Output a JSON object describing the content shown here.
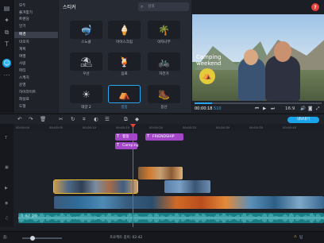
{
  "sidebar": {
    "items": [
      {
        "label": "모두"
      },
      {
        "label": "즐겨찾기"
      },
      {
        "label": "트렌딩"
      },
      {
        "label": "인기"
      },
      {
        "label": "배경"
      },
      {
        "label": "미모지"
      },
      {
        "label": "계획"
      },
      {
        "label": "여행"
      },
      {
        "label": "사랑"
      },
      {
        "label": "파티"
      },
      {
        "label": "스케치"
      },
      {
        "label": "운영"
      },
      {
        "label": "하이라이트"
      },
      {
        "label": "화살표"
      },
      {
        "label": "도형"
      }
    ],
    "selected_index": 4
  },
  "sticker_panel": {
    "title": "스티커",
    "search_placeholder": "검색",
    "stickers": [
      {
        "label": "스노클",
        "icon": "snorkel-icon",
        "glyph": "🤿"
      },
      {
        "label": "아이스크림",
        "icon": "ice-cream-icon",
        "glyph": "🍦"
      },
      {
        "label": "야자나무",
        "icon": "palm-tree-icon",
        "glyph": "🌴"
      },
      {
        "label": "우산",
        "icon": "beach-umbrella-icon",
        "glyph": "⛱"
      },
      {
        "label": "음료",
        "icon": "drink-icon",
        "glyph": "🍹"
      },
      {
        "label": "자전거",
        "icon": "bicycle-icon",
        "glyph": "🚲"
      },
      {
        "label": "태양 2",
        "icon": "sun-icon",
        "glyph": "☀"
      },
      {
        "label": "캠핑",
        "icon": "camping-icon",
        "glyph": "⛺"
      },
      {
        "label": "등산",
        "icon": "hiking-icon",
        "glyph": "🥾"
      }
    ],
    "selected_index": 7
  },
  "preview": {
    "overlay_text": "Camping weekend",
    "badge_icon": "camping-badge-icon",
    "timecode": "00:00:18",
    "timecode_frames": ".510",
    "progress": 0.14,
    "aspect": "16:9"
  },
  "toolbar": {
    "export_label": "내보내기"
  },
  "ruler": {
    "labels": [
      "00:00:00",
      "00:00:05",
      "00:00:10",
      "00:00:15",
      "00:00:20",
      "00:00:25",
      "00:00:30",
      "00:00:35",
      "00:00:40",
      "00:00:45"
    ]
  },
  "timeline": {
    "titles": [
      "캠핑",
      "Camping",
      "FRIENDSHIP"
    ],
    "audio_label": "♫ 배경 음악"
  },
  "status": {
    "zoom_label": "줌:",
    "duration_label": "프로젝트 길이: 02:42",
    "warn": "⚠",
    "tip_label": "팁"
  },
  "colors": {
    "accent": "#1aa3e8",
    "playhead": "#e8413d",
    "title_clip": "#a347c8",
    "audio": "#197d86"
  }
}
